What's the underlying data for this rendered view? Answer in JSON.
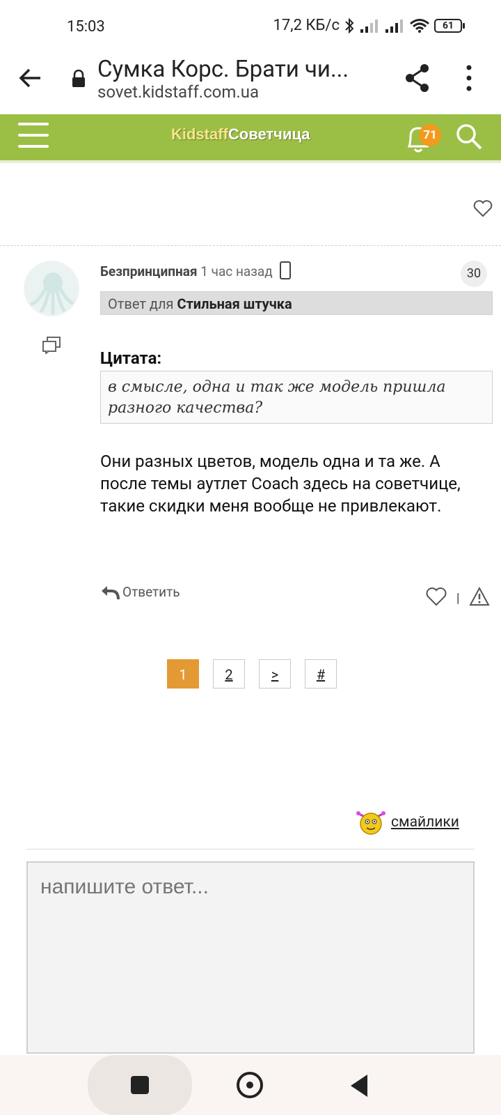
{
  "status": {
    "time": "15:03",
    "speed": "17,2 КБ/с",
    "battery": "61"
  },
  "browser": {
    "title": "Сумка Корс. Брати чи...",
    "domain": "sovet.kidstaff.com.ua"
  },
  "site": {
    "logo_part1": "Kidstaff",
    "logo_part2": "Советчица",
    "notifications_count": "71"
  },
  "post": {
    "author": "Безпринципная",
    "time_ago": "1 час назад",
    "number": "30",
    "reply_to_prefix": "Ответ для",
    "reply_to_name": "Стильная штучка",
    "quote_title": "Цитата:",
    "quote_text": "в смысле, одна и так же модель пришла разного качества?",
    "body": "Они разных цветов, модель одна и та же. А после темы аутлет Coach здесь на советчице, такие скидки меня вообще не привлекают.",
    "reply_label": "Ответить",
    "separator": "|"
  },
  "pagination": {
    "pages": [
      "1",
      "2",
      ">",
      "#"
    ],
    "active": "1"
  },
  "composer": {
    "smileys_label": "смайлики",
    "placeholder": "напишите ответ..."
  },
  "colors": {
    "header_green": "#9bbf44",
    "badge_orange": "#f39a1e",
    "active_page": "#e39a34"
  }
}
